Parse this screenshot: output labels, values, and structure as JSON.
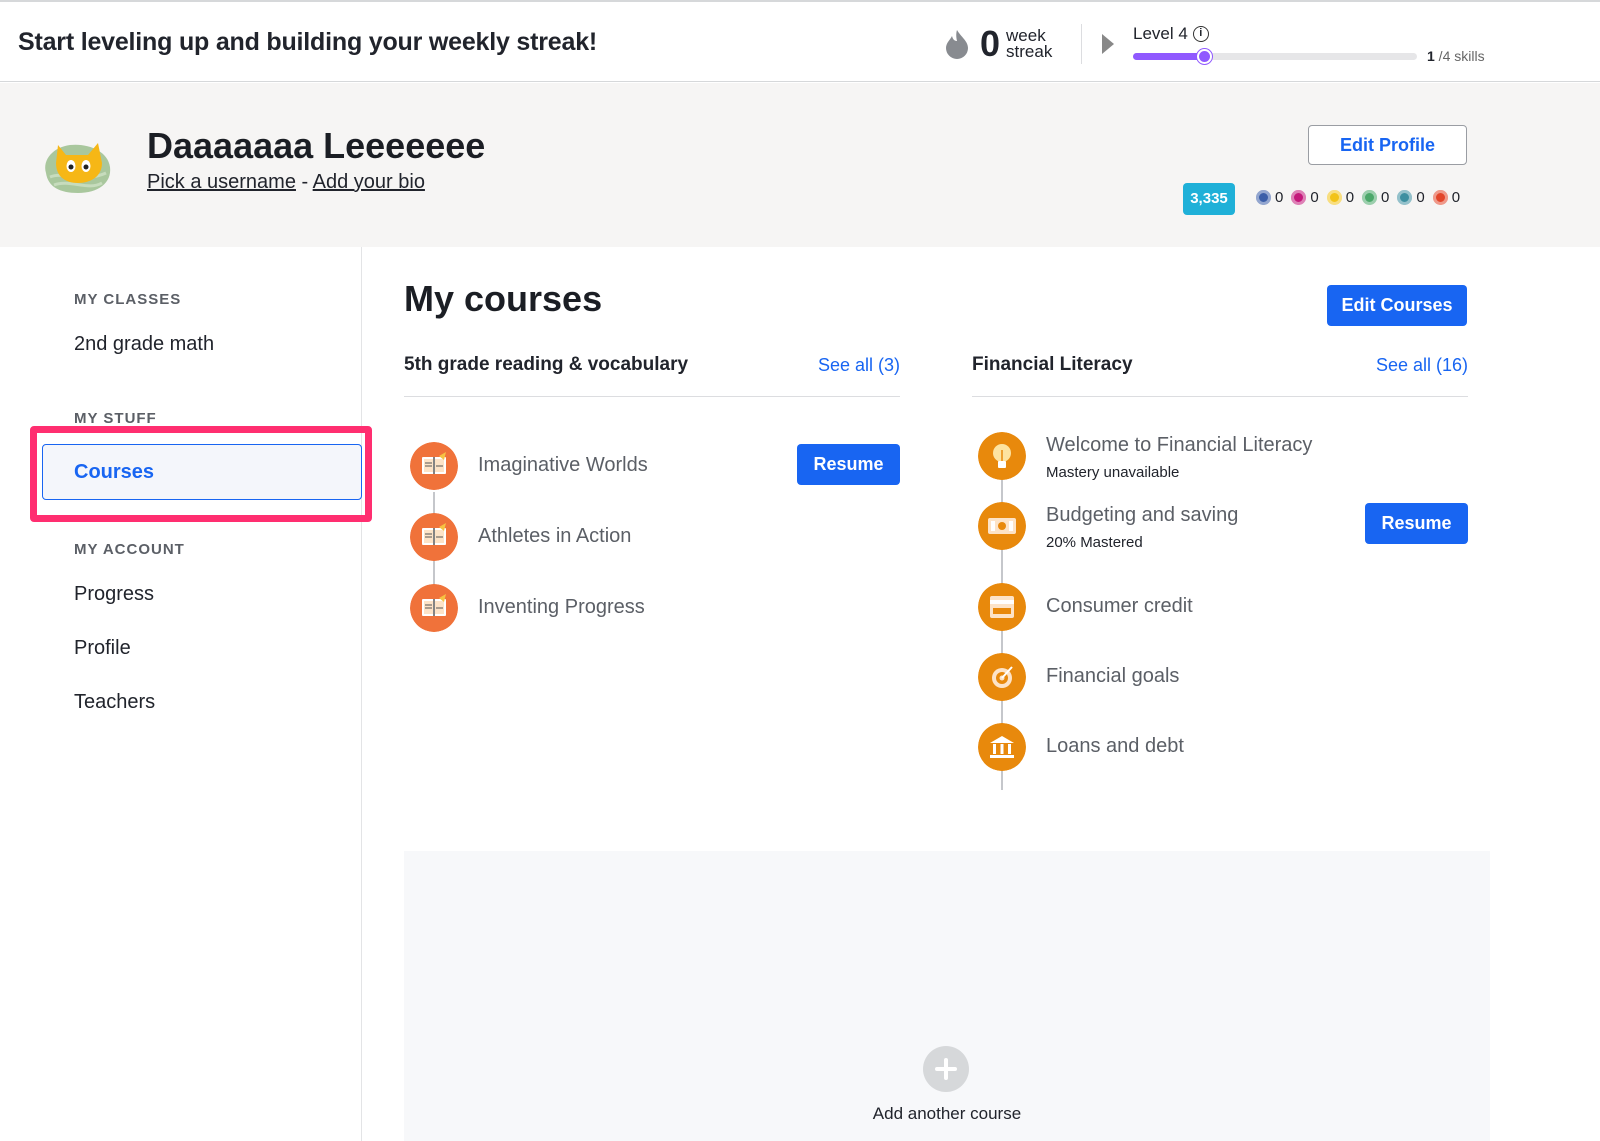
{
  "topbar": {
    "headline": "Start leveling up and building your weekly streak!",
    "streak_count": "0",
    "streak_label_1": "week",
    "streak_label_2": "streak",
    "level_label": "Level 4",
    "skills_done": "1",
    "skills_total": " /4 skills",
    "progress_fraction": 0.25
  },
  "profile": {
    "name": "Daaaaaaa Leeeeeee",
    "username_link": "Pick a username",
    "separator": " - ",
    "bio_link": "Add your bio",
    "edit_button": "Edit Profile",
    "energy_points": "3,335",
    "badges": [
      {
        "name": "meteorite-badge",
        "count": "0",
        "color": "#3b5ea8"
      },
      {
        "name": "black-hole-badge",
        "count": "0",
        "color": "#c4197b"
      },
      {
        "name": "sun-badge",
        "count": "0",
        "color": "#f2c318"
      },
      {
        "name": "earth-badge",
        "count": "0",
        "color": "#4ca86a"
      },
      {
        "name": "moon-badge",
        "count": "0",
        "color": "#3d8fa0"
      },
      {
        "name": "challenge-patch",
        "count": "0",
        "color": "#e2452a"
      }
    ]
  },
  "sidebar": {
    "classes_title": "MY CLASSES",
    "classes": [
      "2nd grade math"
    ],
    "stuff_title": "MY STUFF",
    "courses": "Courses",
    "account_title": "MY ACCOUNT",
    "account_items": [
      "Progress",
      "Profile",
      "Teachers"
    ]
  },
  "main": {
    "title": "My courses",
    "edit_courses": "Edit Courses",
    "courses": [
      {
        "title": "5th grade reading & vocabulary",
        "see_all": "See all (3)",
        "units": [
          {
            "name": "Imaginative Worlds",
            "sub": "",
            "resume": "Resume"
          },
          {
            "name": "Athletes in Action",
            "sub": ""
          },
          {
            "name": "Inventing Progress",
            "sub": ""
          }
        ]
      },
      {
        "title": "Financial Literacy",
        "see_all": "See all (16)",
        "units": [
          {
            "name": "Welcome to Financial Literacy",
            "sub": "Mastery unavailable"
          },
          {
            "name": "Budgeting and saving",
            "sub": "20% Mastered",
            "resume": "Resume"
          },
          {
            "name": "Consumer credit",
            "sub": ""
          },
          {
            "name": "Financial goals",
            "sub": ""
          },
          {
            "name": "Loans and debt",
            "sub": ""
          }
        ]
      }
    ],
    "add_course": "Add another course"
  },
  "colors": {
    "accent": "#1865f2",
    "highlight": "#ff2e70",
    "level_bar": "#9059ff",
    "reading_icon": "#f0723a",
    "finance_icon": "#e8890c"
  }
}
